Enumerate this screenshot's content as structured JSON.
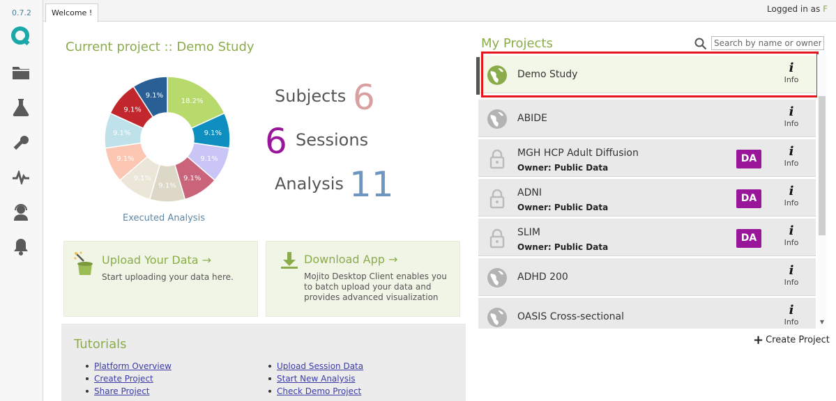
{
  "app": {
    "version": "0.7.2"
  },
  "tabs": [
    {
      "label": "Welcome !"
    }
  ],
  "header": {
    "logged_in_text": "Logged in as",
    "logged_in_tail": "F"
  },
  "current_project": {
    "title": "Current project :: Demo Study"
  },
  "stats": {
    "subjects_label": "Subjects",
    "subjects_value": "6",
    "sessions_label": "Sessions",
    "sessions_value": "6",
    "analysis_label": "Analysis",
    "analysis_value": "11"
  },
  "chart_data": {
    "type": "pie",
    "title": "",
    "caption": "Executed Analysis",
    "slices": [
      {
        "value": 18.2,
        "label": "18.2%",
        "color": "#b8d96b"
      },
      {
        "value": 9.1,
        "label": "9.1%",
        "color": "#0e8fc0"
      },
      {
        "value": 9.1,
        "label": "9.1%",
        "color": "#c9c6f7"
      },
      {
        "value": 9.1,
        "label": "9.1%",
        "color": "#c9647a"
      },
      {
        "value": 9.1,
        "label": "9.1%",
        "color": "#dcd7c6"
      },
      {
        "value": 9.1,
        "label": "9.1%",
        "color": "#ebe6d7"
      },
      {
        "value": 9.1,
        "label": "9.1%",
        "color": "#fbc7b3"
      },
      {
        "value": 9.1,
        "label": "9.1%",
        "color": "#bfe2ea"
      },
      {
        "value": 9.1,
        "label": "9.1%",
        "color": "#c1272d"
      },
      {
        "value": 9.1,
        "label": "9.1%",
        "color": "#2a5f95"
      }
    ]
  },
  "upload_card": {
    "title": "Upload Your Data →",
    "description": "Start uploading your data here."
  },
  "download_card": {
    "title": "Download App →",
    "description": "Mojito Desktop Client enables you to batch upload your data and provides advanced visualization"
  },
  "tutorials": {
    "title": "Tutorials",
    "left": [
      "Platform Overview",
      "Create Project",
      "Share Project"
    ],
    "right": [
      "Upload Session Data",
      "Start New Analysis",
      "Check Demo Project"
    ]
  },
  "my_projects": {
    "title": "My Projects",
    "search_placeholder": "Search by name or owner",
    "info_label": "Info",
    "info_glyph": "i",
    "create_label": "Create Project",
    "items": [
      {
        "name": "Demo Study",
        "owner": "",
        "badge": "",
        "icon": "globe-icon",
        "active": true
      },
      {
        "name": "ABIDE",
        "owner": "",
        "badge": "",
        "icon": "globe-icon"
      },
      {
        "name": "MGH HCP Adult Diffusion",
        "owner": "Owner: Public Data",
        "badge": "DA",
        "icon": "lock-icon"
      },
      {
        "name": "ADNI",
        "owner": "Owner: Public Data",
        "badge": "DA",
        "icon": "lock-icon"
      },
      {
        "name": "SLIM",
        "owner": "Owner: Public Data",
        "badge": "DA",
        "icon": "lock-icon"
      },
      {
        "name": "ADHD 200",
        "owner": "",
        "badge": "",
        "icon": "globe-icon"
      },
      {
        "name": "OASIS Cross-sectional",
        "owner": "",
        "badge": "",
        "icon": "globe-icon"
      }
    ]
  },
  "colors": {
    "accent_green": "#8aac4a",
    "purple": "#99169a",
    "highlight_red": "#e4151b"
  }
}
